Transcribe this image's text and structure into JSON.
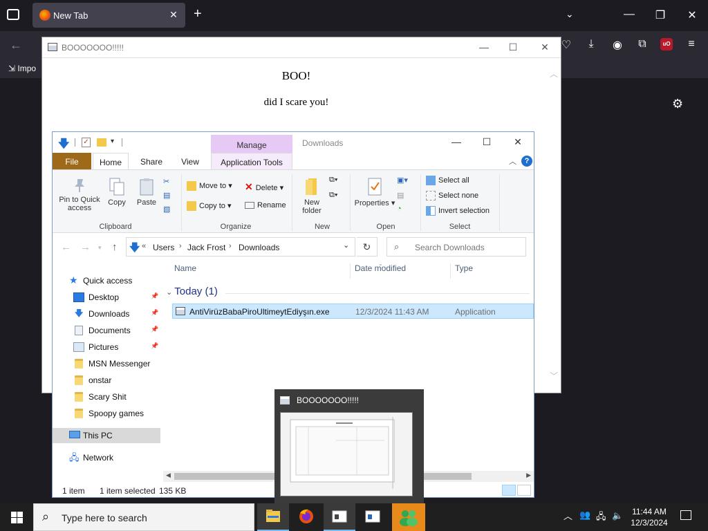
{
  "browser": {
    "tab_title": "New Tab",
    "bookmark_import": "Impo"
  },
  "boo_window": {
    "title": "BOOOOOOO!!!!!",
    "heading": "BOO!",
    "text": "did I scare you!"
  },
  "explorer": {
    "title": "Downloads",
    "manage_tab": "Manage",
    "tabs": [
      "File",
      "Home",
      "Share",
      "View",
      "Application Tools"
    ],
    "clipboard": {
      "pin": "Pin to Quick access",
      "copy": "Copy",
      "paste": "Paste",
      "label": "Clipboard"
    },
    "organize": {
      "move_to": "Move to",
      "copy_to": "Copy to",
      "delete": "Delete",
      "rename": "Rename",
      "label": "Organize"
    },
    "new": {
      "new_folder": "New folder",
      "label": "New"
    },
    "open": {
      "properties": "Properties",
      "label": "Open"
    },
    "select": {
      "select_all": "Select all",
      "select_none": "Select none",
      "invert": "Invert selection",
      "label": "Select"
    },
    "breadcrumb": [
      "Users",
      "Jack Frost",
      "Downloads"
    ],
    "search_placeholder": "Search Downloads",
    "nav": [
      {
        "label": "Quick access"
      },
      {
        "label": "Desktop"
      },
      {
        "label": "Downloads"
      },
      {
        "label": "Documents"
      },
      {
        "label": "Pictures"
      },
      {
        "label": "MSN Messenger"
      },
      {
        "label": "onstar"
      },
      {
        "label": "Scary Shit"
      },
      {
        "label": "Spoopy games"
      },
      {
        "label": "This PC"
      },
      {
        "label": "Network"
      }
    ],
    "columns": [
      "Name",
      "Date modified",
      "Type"
    ],
    "group": "Today (1)",
    "file": {
      "name": "AntiVirüzBabaPiroUltimeytEdiyşın.exe",
      "date": "12/3/2024 11:43 AM",
      "type": "Application"
    },
    "status": {
      "items": "1 item",
      "selected": "1 item selected",
      "size": "135 KB"
    }
  },
  "taskbar": {
    "search_placeholder": "Type here to search",
    "thumbnail_title": "BOOOOOOO!!!!!",
    "time": "11:44 AM",
    "date": "12/3/2024"
  }
}
